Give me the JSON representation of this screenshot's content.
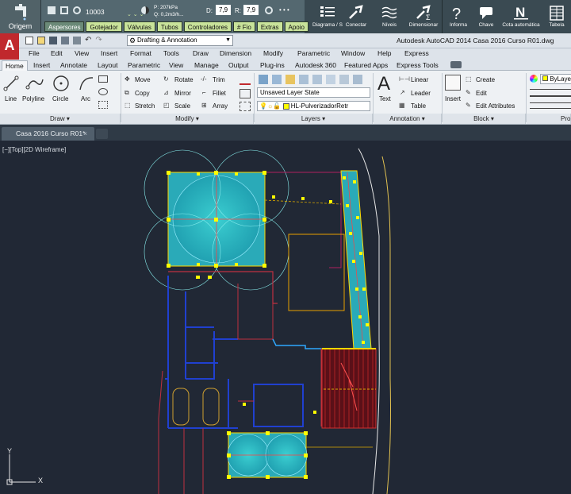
{
  "ext_toolbar": {
    "origem_label": "Origem",
    "counter": "10003",
    "pressure": "P: 207kPa",
    "flow": "Q: 0,2m3/h...",
    "d_label": "D:",
    "d_value": "7,9",
    "r_label": "R:",
    "r_value": "7,9",
    "tags": [
      "Aspersores",
      "Gotejador",
      "Válvulas",
      "Tubos",
      "Controladores",
      "# Fio",
      "Extras",
      "Apoio"
    ],
    "buttons": [
      "Diagrama / S",
      "Conectar",
      "Níveis",
      "Dimensionar",
      "Informa",
      "Chave",
      "Cota automática",
      "Tabela"
    ]
  },
  "quick_access": {
    "workspace": "Drafting & Annotation",
    "window_title": "Autodesk AutoCAD 2014    Casa 2016 Curso R01.dwg"
  },
  "menubar": [
    "File",
    "Edit",
    "View",
    "Insert",
    "Format",
    "Tools",
    "Draw",
    "Dimension",
    "Modify",
    "Parametric",
    "Window",
    "Help",
    "Express"
  ],
  "ribbon_tabs": [
    "Home",
    "Insert",
    "Annotate",
    "Layout",
    "Parametric",
    "View",
    "Manage",
    "Output",
    "Plug-ins",
    "Autodesk 360",
    "Featured Apps",
    "Express Tools"
  ],
  "ribbon": {
    "draw": {
      "line": "Line",
      "polyline": "Polyline",
      "circle": "Circle",
      "arc": "Arc",
      "panel": "Draw"
    },
    "modify": {
      "move": "Move",
      "rotate": "Rotate",
      "trim": "Trim",
      "copy": "Copy",
      "mirror": "Mirror",
      "fillet": "Fillet",
      "stretch": "Stretch",
      "scale": "Scale",
      "array": "Array",
      "panel": "Modify"
    },
    "layers": {
      "layer_state": "Unsaved Layer State",
      "current_layer": "HL-PulverizadorRetr",
      "panel": "Layers"
    },
    "annotation": {
      "text": "Text",
      "linear": "Linear",
      "leader": "Leader",
      "table": "Table",
      "panel": "Annotation"
    },
    "block": {
      "insert": "Insert",
      "create": "Create",
      "edit": "Edit",
      "edit_attributes": "Edit Attributes",
      "panel": "Block"
    },
    "properties": {
      "color": "ByLaye",
      "panel": "Pro"
    }
  },
  "document_tab": "Casa 2016 Curso R01*",
  "viewport_label": "[−][Top][2D Wireframe]",
  "ucs": {
    "x": "X",
    "y": "Y"
  },
  "colors": {
    "accent_red": "#c0282d",
    "tag_green": "#c9e39a",
    "canvas": "#212835",
    "sprinkler": "#2fc6c6"
  }
}
